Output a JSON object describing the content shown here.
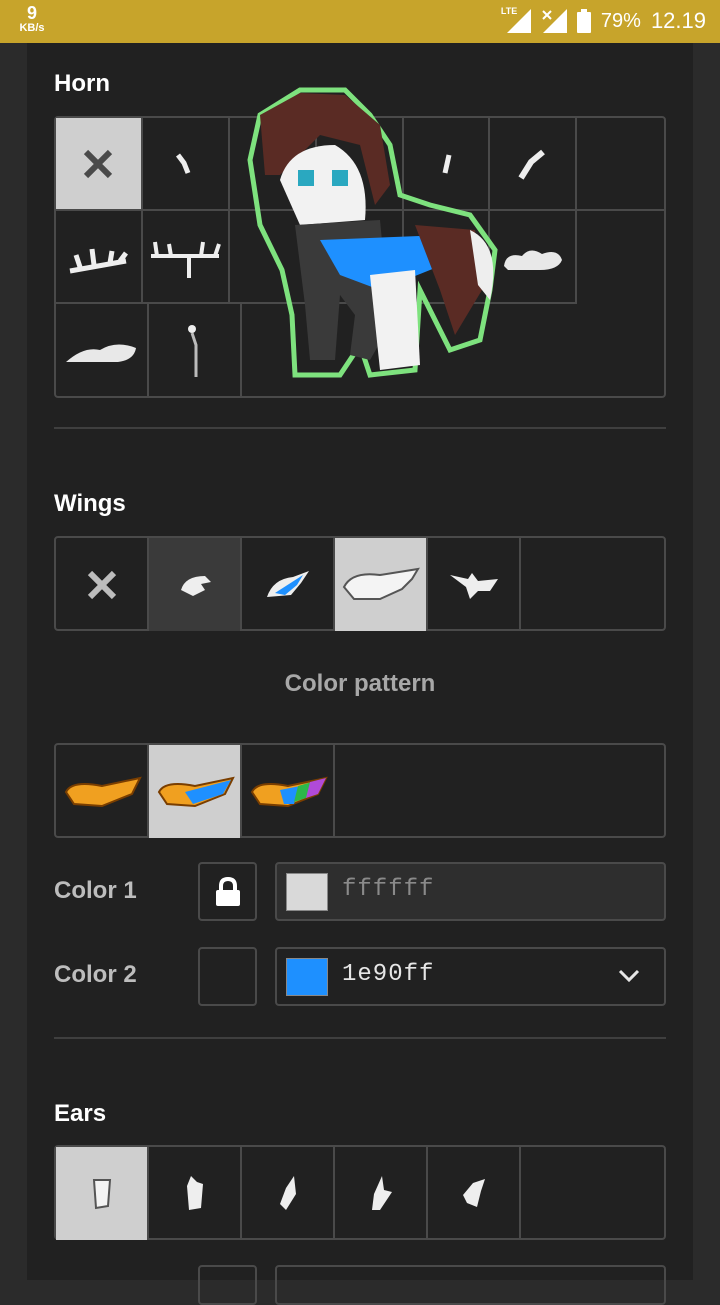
{
  "status_bar": {
    "speed_value": "9",
    "speed_unit": "KB/s",
    "network": "LTE",
    "battery": "79%",
    "time": "12.19"
  },
  "horn": {
    "title": "Horn",
    "options": [
      "none",
      "horn-1",
      "horn-2",
      "horn-3",
      "horn-4",
      "horn-5",
      "horn-6",
      "horn-7",
      "horn-8",
      "horn-9",
      "horn-10",
      "horn-11",
      "horn-12",
      "horn-13"
    ],
    "selected": "none"
  },
  "wings": {
    "title": "Wings",
    "options": [
      "none",
      "wings-small",
      "wings-blue",
      "wings-large",
      "wings-bat"
    ],
    "selected": "wings-large",
    "color_pattern_label": "Color pattern",
    "patterns": [
      "single",
      "two-tone",
      "multi"
    ],
    "selected_pattern": "two-tone",
    "color1": {
      "label": "Color 1",
      "value": "ffffff",
      "locked": true,
      "swatch": "#d9d9d9"
    },
    "color2": {
      "label": "Color 2",
      "value": "1e90ff",
      "locked": false,
      "swatch": "#1e90ff"
    }
  },
  "ears": {
    "title": "Ears",
    "options": [
      "ears-1",
      "ears-2",
      "ears-3",
      "ears-4",
      "ears-5"
    ],
    "selected": "ears-1"
  },
  "colors": {
    "panel": "#212121",
    "accent": "#c7a42b",
    "pony_outline": "#7ee27e",
    "pony_mane": "#5a2b24",
    "wing_blue": "#1e90ff"
  }
}
